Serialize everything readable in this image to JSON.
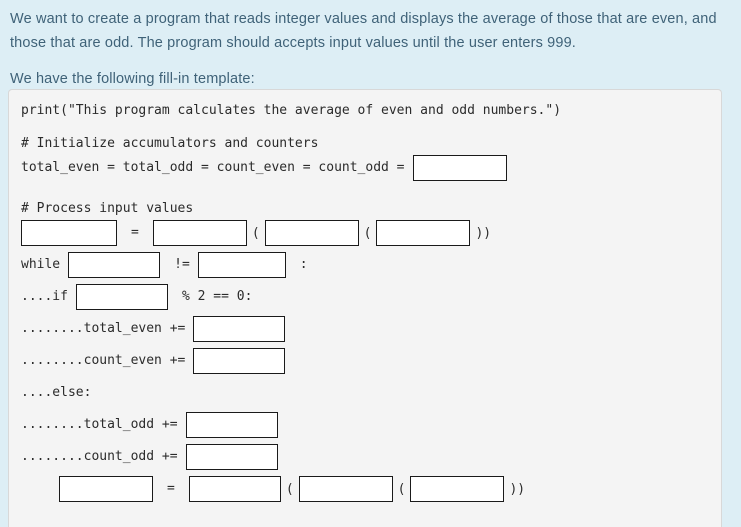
{
  "question": {
    "paragraph1": "We want to create a program that reads integer values and displays the average of those that are even, and those that are odd. The program should accepts input values until the user enters 999.",
    "paragraph2": "We have the following fill-in template:"
  },
  "colors": {
    "page_background": "#ddeef5",
    "panel_background": "#f4f4f4",
    "panel_border": "#d8d8d8",
    "prompt_text": "#3f6278",
    "code_text": "#2b2b2b",
    "input_border": "#1a1a1a",
    "input_background": "#ffffff"
  },
  "code_template": {
    "line_print": "print(\"This program calculates the average of even and odd numbers.\")",
    "comment_init": "# Initialize accumulators and counters",
    "init_assign": "total_even = total_odd = count_even = count_odd =",
    "comment_process": "# Process input values",
    "equals": "=",
    "open_paren": "(",
    "close_parens": "))",
    "while_keyword": "while",
    "not_equal": "!=",
    "colon": ":",
    "if_keyword": "....if",
    "mod_check": "% 2 == 0:",
    "total_even_line": "........total_even +=",
    "count_even_line": "........count_even +=",
    "else_keyword": "....else:",
    "total_odd_line": "........total_odd +=",
    "count_odd_line": "........count_odd +="
  },
  "inputs": {
    "init_value": "",
    "init_placeholder": "",
    "read_target": "",
    "read_func": "",
    "read_cast": "",
    "read_prompt": "",
    "while_var": "",
    "while_sentinel": "",
    "if_var": "",
    "total_even_add": "",
    "count_even_add": "",
    "total_odd_add": "",
    "count_odd_add": "",
    "loop_target": "",
    "loop_func": "",
    "loop_cast": "",
    "loop_prompt": ""
  }
}
